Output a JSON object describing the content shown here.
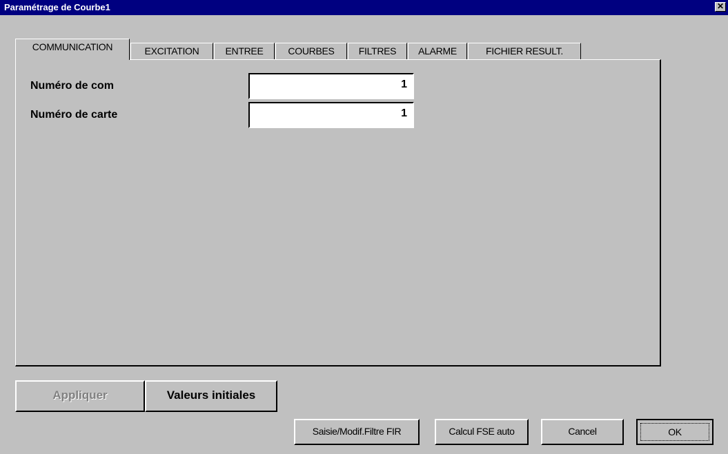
{
  "window": {
    "title": "Paramétrage de Courbe1",
    "close_glyph": "✕"
  },
  "tabs": [
    {
      "label": "COMMUNICATION",
      "active": true
    },
    {
      "label": "EXCITATION",
      "active": false
    },
    {
      "label": "ENTREE",
      "active": false
    },
    {
      "label": "COURBES",
      "active": false
    },
    {
      "label": "FILTRES",
      "active": false
    },
    {
      "label": "ALARME",
      "active": false
    },
    {
      "label": "FICHIER RESULT.",
      "active": false
    }
  ],
  "fields": [
    {
      "label": "Numéro de com",
      "value": "1"
    },
    {
      "label": "Numéro de carte",
      "value": "1"
    }
  ],
  "buttons": {
    "apply": "Appliquer",
    "initial_values": "Valeurs initiales",
    "fir_filter": "Saisie/Modif.Filtre FIR",
    "fse_auto": "Calcul FSE auto",
    "cancel": "Cancel",
    "ok": "OK"
  },
  "colors": {
    "titlebar": "#000080",
    "face": "#c0c0c0"
  },
  "icons": {
    "close": "close-icon"
  }
}
